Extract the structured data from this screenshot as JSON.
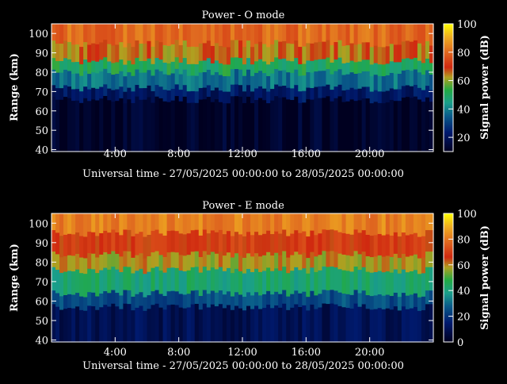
{
  "chart_data": [
    {
      "type": "heatmap",
      "title": "Power - O mode",
      "xlabel": "Universal time - 27/05/2025 00:00:00 to 28/05/2025 00:00:00",
      "ylabel": "Range (km)",
      "xlim": [
        0,
        24
      ],
      "ylim": [
        39,
        105
      ],
      "x_ticks": [
        "4:00",
        "8:00",
        "12:00",
        "16:00",
        "20:00"
      ],
      "y_ticks": [
        40,
        50,
        60,
        70,
        80,
        90,
        100
      ],
      "colorbar": {
        "label": "Signal power (dB)",
        "range": [
          10,
          100
        ],
        "ticks": [
          20,
          40,
          60,
          80,
          100
        ]
      },
      "bands": [
        {
          "range_km": [
            39,
            66
          ],
          "power_db": 12
        },
        {
          "range_km": [
            66,
            72
          ],
          "power_db": 22
        },
        {
          "range_km": [
            72,
            80
          ],
          "power_db": 38
        },
        {
          "range_km": [
            80,
            86
          ],
          "power_db": 50
        },
        {
          "range_km": [
            86,
            95
          ],
          "power_db": 65
        },
        {
          "range_km": [
            95,
            105
          ],
          "power_db": 80
        }
      ]
    },
    {
      "type": "heatmap",
      "title": "Power - E mode",
      "xlabel": "Universal time - 27/05/2025 00:00:00 to 28/05/2025 00:00:00",
      "ylabel": "Range (km)",
      "xlim": [
        0,
        24
      ],
      "ylim": [
        39,
        105
      ],
      "x_ticks": [
        "4:00",
        "8:00",
        "12:00",
        "16:00",
        "20:00"
      ],
      "y_ticks": [
        40,
        50,
        60,
        70,
        80,
        90,
        100
      ],
      "colorbar": {
        "label": "Signal power (dB)",
        "range": [
          0,
          100
        ],
        "ticks": [
          0,
          20,
          40,
          60,
          80,
          100
        ]
      },
      "bands": [
        {
          "range_km": [
            39,
            57
          ],
          "power_db": 10
        },
        {
          "range_km": [
            57,
            64
          ],
          "power_db": 25
        },
        {
          "range_km": [
            64,
            76
          ],
          "power_db": 42
        },
        {
          "range_km": [
            76,
            84
          ],
          "power_db": 58
        },
        {
          "range_km": [
            84,
            95
          ],
          "power_db": 68
        },
        {
          "range_km": [
            95,
            105
          ],
          "power_db": 82
        }
      ]
    }
  ]
}
